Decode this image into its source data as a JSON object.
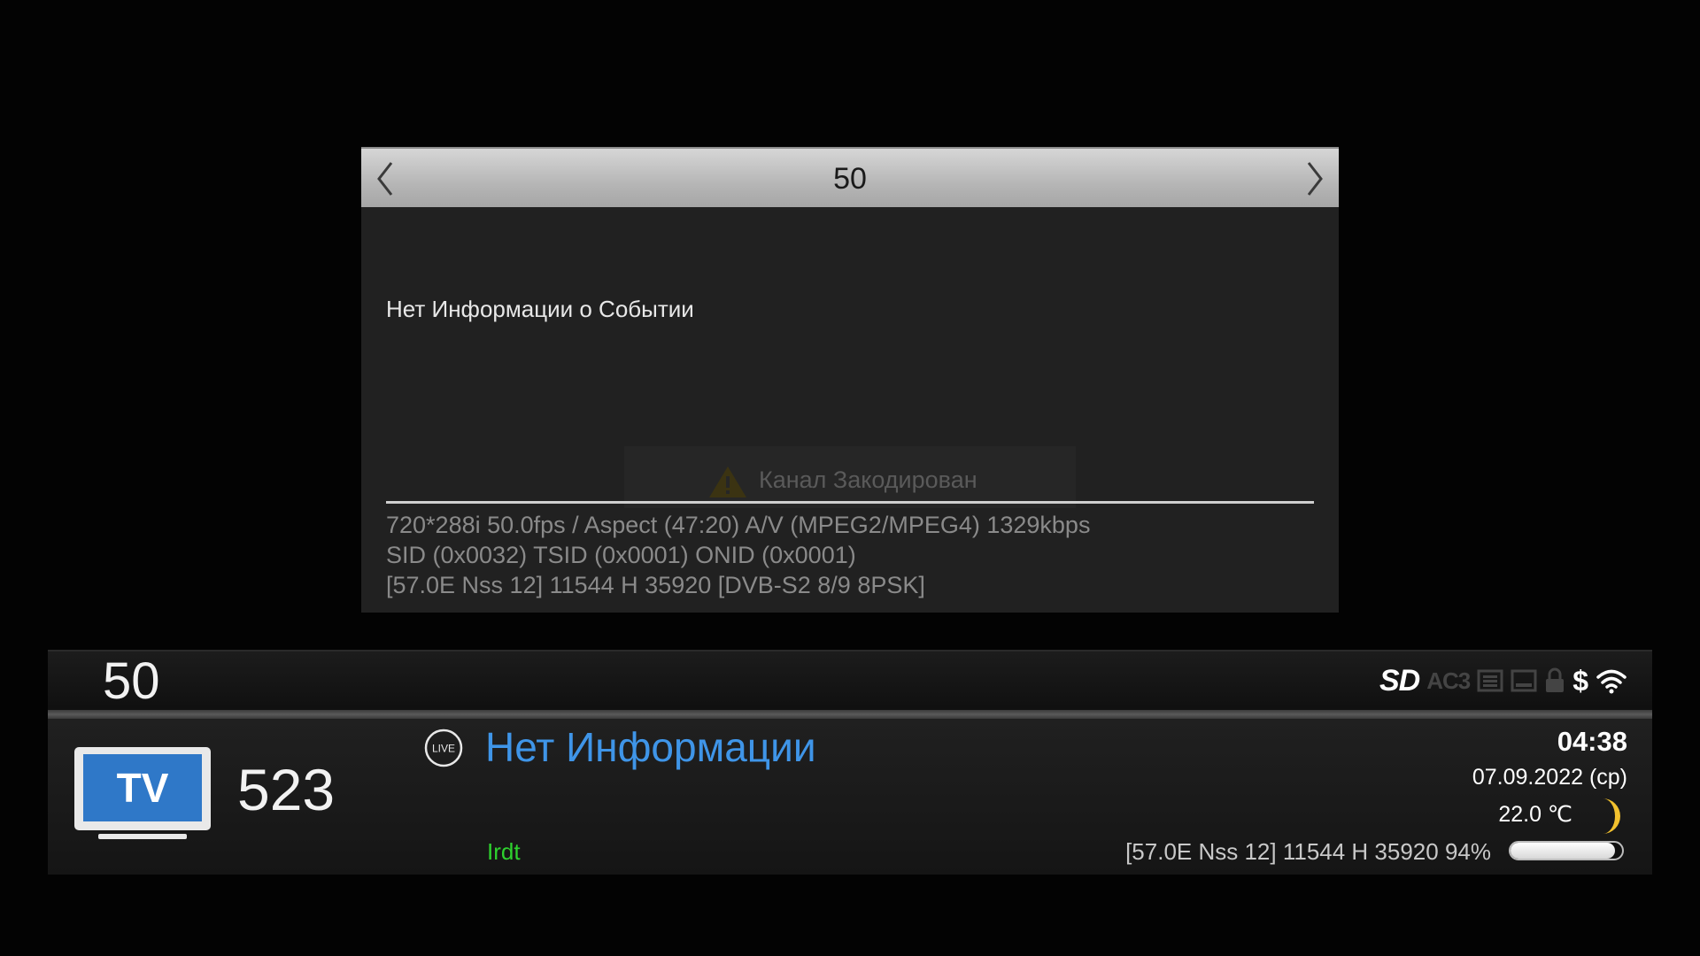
{
  "dialog": {
    "title": "50",
    "event_text": "Нет Информации о Событии",
    "scrambled_text": "Канал Закодирован",
    "tech_lines": [
      "720*288i 50.0fps / Aspect (47:20)  A/V (MPEG2/MPEG4) 1329kbps",
      "SID (0x0032) TSID (0x0001) ONID (0x0001)",
      "[57.0E Nss 12] 11544 H 35920 [DVB-S2 8/9 8PSK]"
    ],
    "icons": [
      "chevron-left-icon",
      "chevron-right-icon",
      "warning-icon"
    ]
  },
  "infobar": {
    "channel_number": "50",
    "status_icons": {
      "sd": "SD",
      "ac3": "AC3",
      "teletext": "teletext-icon",
      "subtitle": "subtitle-icon",
      "lock": "lock-icon",
      "crypt": "$",
      "network": "wifi-icon"
    },
    "logo_text": "TV",
    "service_number": "523",
    "live_label": "LIVE",
    "event_title": "Нет Информации",
    "provider": "Irdt",
    "time": "04:38",
    "date": "07.09.2022 (ср)",
    "temperature": "22.0 ℃",
    "tuner_info": "[57.0E Nss 12] 11544 H 35920  94%",
    "signal_percent": 94,
    "colors": {
      "event_title": "#3f95e8",
      "provider": "#2ed12e",
      "tv_logo": "#2f78c8",
      "moon": "#f2c12e"
    }
  }
}
